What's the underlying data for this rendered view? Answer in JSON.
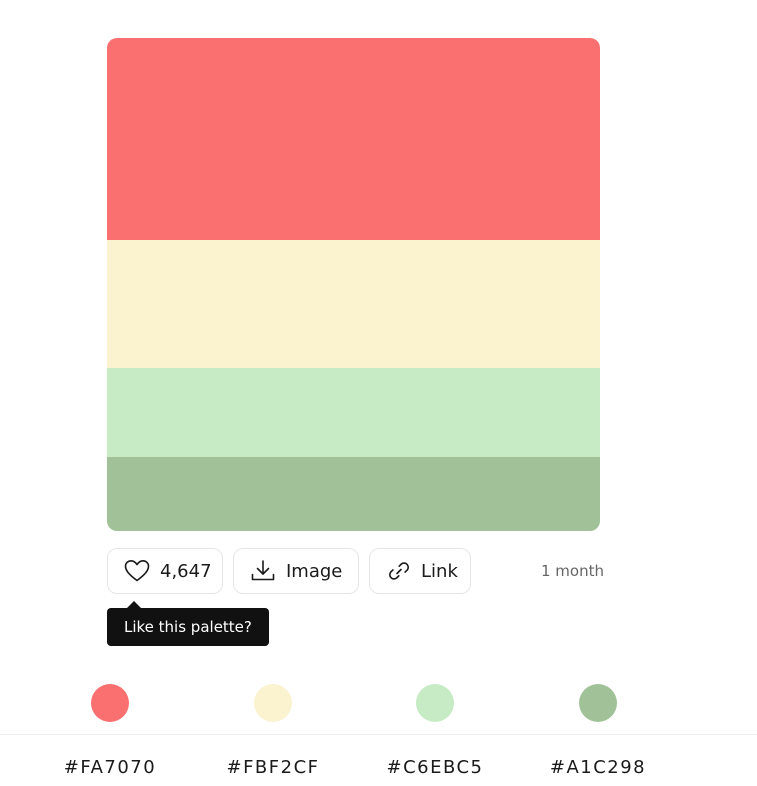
{
  "palette": {
    "colors": [
      {
        "hex": "#FA7070",
        "label": "#FA7070"
      },
      {
        "hex": "#FBF2CF",
        "label": "#FBF2CF"
      },
      {
        "hex": "#C6EBC5",
        "label": "#C6EBC5"
      },
      {
        "hex": "#A1C298",
        "label": "#A1C298"
      }
    ]
  },
  "actions": {
    "likes_count": "4,647",
    "image_label": "Image",
    "link_label": "Link",
    "timestamp": "1 month"
  },
  "tooltip": {
    "text": "Like this palette?"
  },
  "icons": {
    "like": "heart-icon",
    "image": "download-icon",
    "link": "link-icon"
  }
}
